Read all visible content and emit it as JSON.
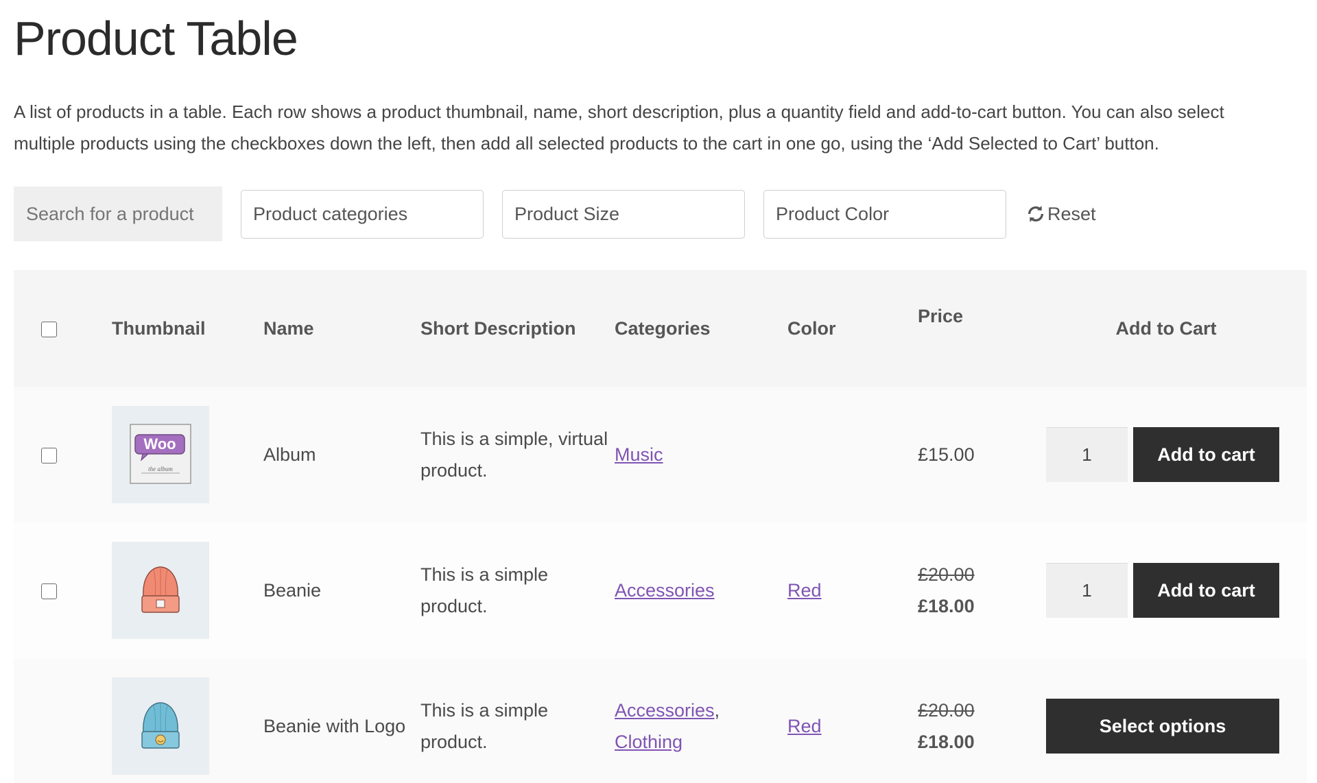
{
  "page": {
    "title": "Product Table",
    "intro": "A list of products in a table. Each row shows a product thumbnail, name, short description, plus a quantity field and add-to-cart button. You can also select multiple products using the checkboxes down the left, then add all selected products to the cart in one go, using the ‘Add Selected to Cart’ button."
  },
  "filters": {
    "search_placeholder": "Search for a product",
    "categories": "Product categories",
    "size": "Product Size",
    "color": "Product Color",
    "reset": "Reset"
  },
  "table": {
    "headers": {
      "thumbnail": "Thumbnail",
      "name": "Name",
      "short_description": "Short Description",
      "categories": "Categories",
      "color": "Color",
      "price": "Price",
      "add_to_cart": "Add to Cart"
    },
    "rows": [
      {
        "name": "Album",
        "description": "This is a simple, virtual product.",
        "category_1": "Music",
        "category_sep": "",
        "category_2": "",
        "color": "",
        "price_old": "",
        "price": "£15.00",
        "qty": "1",
        "button": "Add to cart"
      },
      {
        "name": "Beanie",
        "description": "This is a simple product.",
        "category_1": "Accessories",
        "category_sep": "",
        "category_2": "",
        "color": "Red",
        "price_old": "£20.00",
        "price": "£18.00",
        "qty": "1",
        "button": "Add to cart"
      },
      {
        "name": "Beanie with Logo",
        "description": "This is a simple product.",
        "category_1": "Accessories",
        "category_sep": ",",
        "category_2": "Clothing",
        "color": "Red",
        "price_old": "£20.00",
        "price": "£18.00",
        "qty": "",
        "button": "Select options"
      }
    ]
  },
  "thumbnails": {
    "album_logo_text": "Woo",
    "album_caption": "the album"
  },
  "colors": {
    "link": "#7f54b3",
    "button_bg": "#2f2f2f",
    "header_bg": "#f5f5f5",
    "thumb_bg": "#e9eef2"
  }
}
